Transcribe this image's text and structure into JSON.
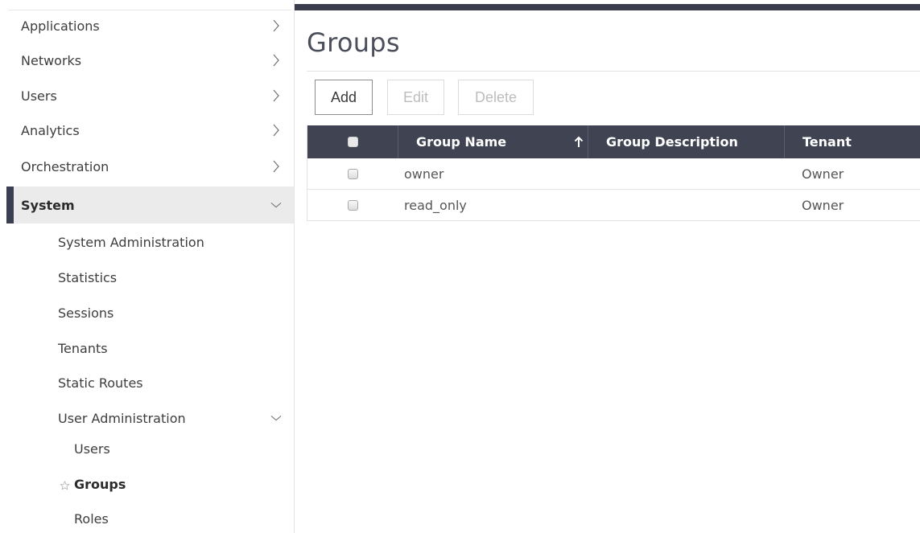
{
  "sidebar": {
    "nav": [
      {
        "label": "Applications"
      },
      {
        "label": "Networks"
      },
      {
        "label": "Users"
      },
      {
        "label": "Analytics"
      },
      {
        "label": "Orchestration"
      }
    ],
    "active": {
      "label": "System"
    },
    "system_items": [
      {
        "label": "System Administration"
      },
      {
        "label": "Statistics"
      },
      {
        "label": "Sessions"
      },
      {
        "label": "Tenants"
      },
      {
        "label": "Static Routes"
      }
    ],
    "user_admin": {
      "label": "User Administration"
    },
    "user_admin_items": [
      {
        "label": "Users"
      },
      {
        "label": "Groups"
      },
      {
        "label": "Roles"
      }
    ],
    "current_item": "Groups"
  },
  "main": {
    "title": "Groups",
    "toolbar": {
      "add": "Add",
      "edit": "Edit",
      "delete": "Delete"
    },
    "table": {
      "headers": {
        "group_name": "Group Name",
        "group_description": "Group Description",
        "tenant": "Tenant"
      },
      "sort": {
        "column": "Group Name",
        "direction": "ascending"
      },
      "rows": [
        {
          "group_name": "owner",
          "group_description": "",
          "tenant": "Owner"
        },
        {
          "group_name": "read_only",
          "group_description": "",
          "tenant": "Owner"
        }
      ]
    }
  },
  "colors": {
    "header_bg": "#3f4352",
    "topbar": "#383c4c",
    "active_accent": "#3a3f51"
  },
  "icons": {
    "nav_chevron": "chevron-right-icon",
    "expanded_chevron": "chevron-down-icon",
    "favorite": "star-outline-icon",
    "sort": "arrow-up-icon"
  }
}
